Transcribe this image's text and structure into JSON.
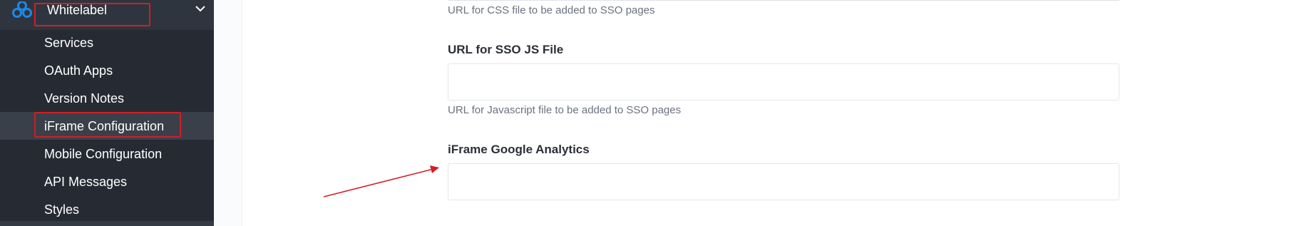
{
  "sidebar": {
    "section_label": "Whitelabel",
    "items": [
      {
        "label": "Services"
      },
      {
        "label": "OAuth Apps"
      },
      {
        "label": "Version Notes"
      },
      {
        "label": "iFrame Configuration"
      },
      {
        "label": "Mobile Configuration"
      },
      {
        "label": "API Messages"
      },
      {
        "label": "Styles"
      }
    ]
  },
  "form": {
    "css_help": "URL for CSS file to be added to SSO pages",
    "sso_js": {
      "label": "URL for SSO JS File",
      "value": "",
      "help": "URL for Javascript file to be added to SSO pages"
    },
    "iframe_ga": {
      "label": "iFrame Google Analytics",
      "value": ""
    }
  },
  "colors": {
    "sidebar_bg": "#262b33",
    "highlight_box": "#d01f26",
    "arrow": "#d01f26",
    "brand_icon": "#1e88e5"
  }
}
